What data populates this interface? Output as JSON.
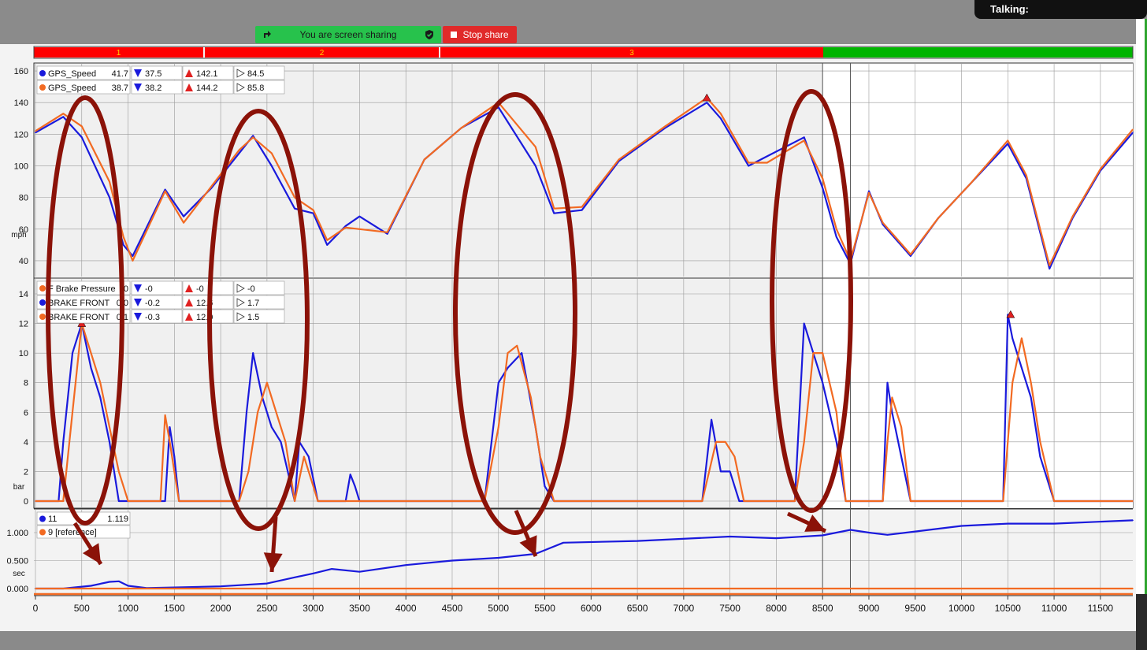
{
  "zoom_app": {
    "talking_label": "Talking:",
    "share_banner_text": "You are screen sharing",
    "stop_share_label": "Stop share",
    "colors": {
      "banner": "#27c24c",
      "stop": "#e02a2a"
    }
  },
  "segments": {
    "labels": [
      "1",
      "2",
      "3"
    ],
    "colors": {
      "active": "#ff0000",
      "done": "#00b400"
    }
  },
  "panels": {
    "speed": {
      "unit": "mph",
      "yticks": [
        "160",
        "140",
        "120",
        "100",
        "80",
        "60",
        "40"
      ],
      "legend": [
        {
          "name": "GPS_Speed",
          "value": "41.7",
          "min": "37.5",
          "max": "142.1",
          "avg": "84.5",
          "color": "#1a1adc"
        },
        {
          "name": "GPS_Speed",
          "value": "38.7",
          "min": "38.2",
          "max": "144.2",
          "avg": "85.8",
          "color": "#f26a22"
        }
      ]
    },
    "brake": {
      "unit": "bar",
      "yticks": [
        "14",
        "12",
        "10",
        "8",
        "6",
        "4",
        "2",
        "0"
      ],
      "legend": [
        {
          "name": "F Brake Pressure",
          "value": "-0",
          "min": "-0",
          "max": "-0",
          "avg": "-0",
          "color": "#f26a22"
        },
        {
          "name": "BRAKE FRONT",
          "value": "0.0",
          "min": "-0.2",
          "max": "12.6",
          "avg": "1.7",
          "color": "#1a1adc"
        },
        {
          "name": "BRAKE FRONT",
          "value": "0.1",
          "min": "-0.3",
          "max": "12.0",
          "avg": "1.5",
          "color": "#f26a22"
        }
      ]
    },
    "time": {
      "unit": "sec",
      "yticks": [
        "1.000",
        "0.500",
        "0.000"
      ],
      "legend": [
        {
          "name": "11",
          "value": "1.119",
          "color": "#1a1adc"
        },
        {
          "name": "9 [reference]",
          "value": "",
          "color": "#f26a22"
        }
      ]
    }
  },
  "x_axis": {
    "ticks": [
      "0",
      "500",
      "1000",
      "1500",
      "2000",
      "2500",
      "3000",
      "3500",
      "4000",
      "4500",
      "5000",
      "5500",
      "6000",
      "6500",
      "7000",
      "7500",
      "8000",
      "8500",
      "9000",
      "9500",
      "10000",
      "10500",
      "11000",
      "11500"
    ]
  },
  "chart_data": [
    {
      "type": "line",
      "ylabel": "mph",
      "ylim": [
        30,
        165
      ],
      "xlim": [
        0,
        11850
      ],
      "series": [
        {
          "name": "GPS_Speed",
          "x": [
            0,
            300,
            500,
            800,
            950,
            1050,
            1400,
            1600,
            1900,
            2200,
            2350,
            2550,
            2800,
            3000,
            3150,
            3350,
            3500,
            3800,
            4200,
            4600,
            5000,
            5400,
            5600,
            5900,
            6300,
            6800,
            7250,
            7400,
            7700,
            7900,
            8300,
            8500,
            8650,
            8800,
            9000,
            9150,
            9450,
            9750,
            10100,
            10500,
            10700,
            10950,
            11200,
            11500,
            11850
          ],
          "values": [
            121,
            131,
            118,
            80,
            50,
            43,
            85,
            68,
            86,
            108,
            119,
            100,
            73,
            70,
            50,
            62,
            68,
            57,
            104,
            124,
            137,
            100,
            70,
            72,
            103,
            124,
            140,
            130,
            100,
            106,
            118,
            86,
            55,
            38,
            84,
            63,
            43,
            67,
            89,
            114,
            92,
            35,
            67,
            97,
            121
          ]
        },
        {
          "name": "GPS_Speed",
          "x": [
            0,
            300,
            500,
            800,
            950,
            1050,
            1400,
            1600,
            1900,
            2200,
            2350,
            2550,
            2800,
            3000,
            3150,
            3350,
            3500,
            3800,
            4200,
            4600,
            5000,
            5400,
            5600,
            5900,
            6300,
            6800,
            7250,
            7400,
            7700,
            7900,
            8300,
            8500,
            8650,
            8800,
            9000,
            9150,
            9450,
            9750,
            10100,
            10500,
            10700,
            10950,
            11200,
            11500,
            11850
          ],
          "values": [
            122,
            133,
            125,
            90,
            55,
            40,
            84,
            64,
            87,
            110,
            118,
            108,
            80,
            72,
            53,
            61,
            60,
            58,
            104,
            124,
            140,
            112,
            73,
            74,
            104,
            125,
            143,
            133,
            102,
            102,
            116,
            92,
            60,
            40,
            83,
            64,
            44,
            67,
            89,
            116,
            94,
            37,
            68,
            98,
            123
          ]
        }
      ]
    },
    {
      "type": "line",
      "ylabel": "bar",
      "ylim": [
        -0.5,
        15
      ],
      "xlim": [
        0,
        11850
      ],
      "series": [
        {
          "name": "BRAKE FRONT",
          "x": [
            0,
            250,
            300,
            400,
            500,
            600,
            700,
            800,
            900,
            1000,
            1350,
            1400,
            1450,
            1500,
            1550,
            2200,
            2280,
            2350,
            2450,
            2550,
            2650,
            2800,
            2850,
            2950,
            3050,
            3350,
            3400,
            3450,
            3500,
            4850,
            5000,
            5100,
            5250,
            5400,
            5500,
            5600,
            7200,
            7300,
            7400,
            7500,
            7600,
            8200,
            8300,
            8400,
            8500,
            8650,
            8750,
            9150,
            9200,
            9250,
            9350,
            9450,
            10450,
            10500,
            10550,
            10650,
            10750,
            10850,
            11000,
            11850
          ],
          "values": [
            0,
            0,
            4,
            10,
            12,
            9,
            7,
            4,
            0,
            0,
            0,
            0,
            5,
            3,
            0,
            0,
            6,
            10,
            7,
            5,
            4,
            0,
            4,
            3,
            0,
            0,
            1.8,
            1,
            0,
            0,
            8,
            9,
            10,
            5,
            1,
            0,
            0,
            5.5,
            2,
            2,
            0,
            0,
            12,
            10,
            8,
            4,
            0,
            0,
            8,
            6,
            3,
            0,
            0,
            12.6,
            11,
            9,
            7,
            3,
            0,
            0
          ]
        },
        {
          "name": "BRAKE FRONT",
          "x": [
            0,
            300,
            400,
            500,
            600,
            700,
            800,
            900,
            1000,
            1350,
            1400,
            1450,
            1500,
            1550,
            2200,
            2300,
            2400,
            2500,
            2600,
            2700,
            2800,
            2900,
            2950,
            3000,
            3050,
            4850,
            5000,
            5100,
            5200,
            5350,
            5450,
            5600,
            7200,
            7350,
            7450,
            7550,
            7650,
            8200,
            8300,
            8400,
            8500,
            8650,
            8750,
            9150,
            9200,
            9250,
            9350,
            9450,
            10450,
            10550,
            10650,
            10750,
            10850,
            11000,
            11850
          ],
          "values": [
            0,
            0,
            6,
            12,
            10,
            8,
            5,
            2,
            0,
            0,
            5.8,
            4,
            2,
            0,
            0,
            2,
            6,
            8,
            6,
            4,
            0,
            3,
            2,
            1,
            0,
            0,
            5,
            10,
            10.5,
            7,
            3,
            0,
            0,
            4,
            4,
            3,
            0,
            0,
            4,
            10,
            10,
            6,
            0,
            0,
            4,
            7,
            5,
            0,
            0,
            8,
            11,
            8,
            4,
            0,
            0
          ]
        }
      ]
    },
    {
      "type": "line",
      "ylabel": "sec",
      "ylim": [
        -0.1,
        1.4
      ],
      "xlim": [
        0,
        11850
      ],
      "series": [
        {
          "name": "11",
          "x": [
            0,
            300,
            600,
            800,
            900,
            1000,
            1200,
            1500,
            2000,
            2500,
            2800,
            3000,
            3200,
            3500,
            4000,
            4500,
            5000,
            5400,
            5700,
            6500,
            7500,
            8000,
            8500,
            8800,
            9000,
            9200,
            9500,
            10000,
            10500,
            11000,
            11850
          ],
          "values": [
            0,
            0,
            0.05,
            0.12,
            0.13,
            0.05,
            0.01,
            0.02,
            0.04,
            0.09,
            0.2,
            0.27,
            0.35,
            0.3,
            0.42,
            0.5,
            0.55,
            0.62,
            0.82,
            0.85,
            0.93,
            0.9,
            0.95,
            1.05,
            1.0,
            0.96,
            1.02,
            1.12,
            1.16,
            1.16,
            1.22
          ]
        },
        {
          "name": "9 [reference]",
          "x": [
            0,
            11850
          ],
          "values": [
            0,
            0
          ]
        }
      ]
    }
  ]
}
